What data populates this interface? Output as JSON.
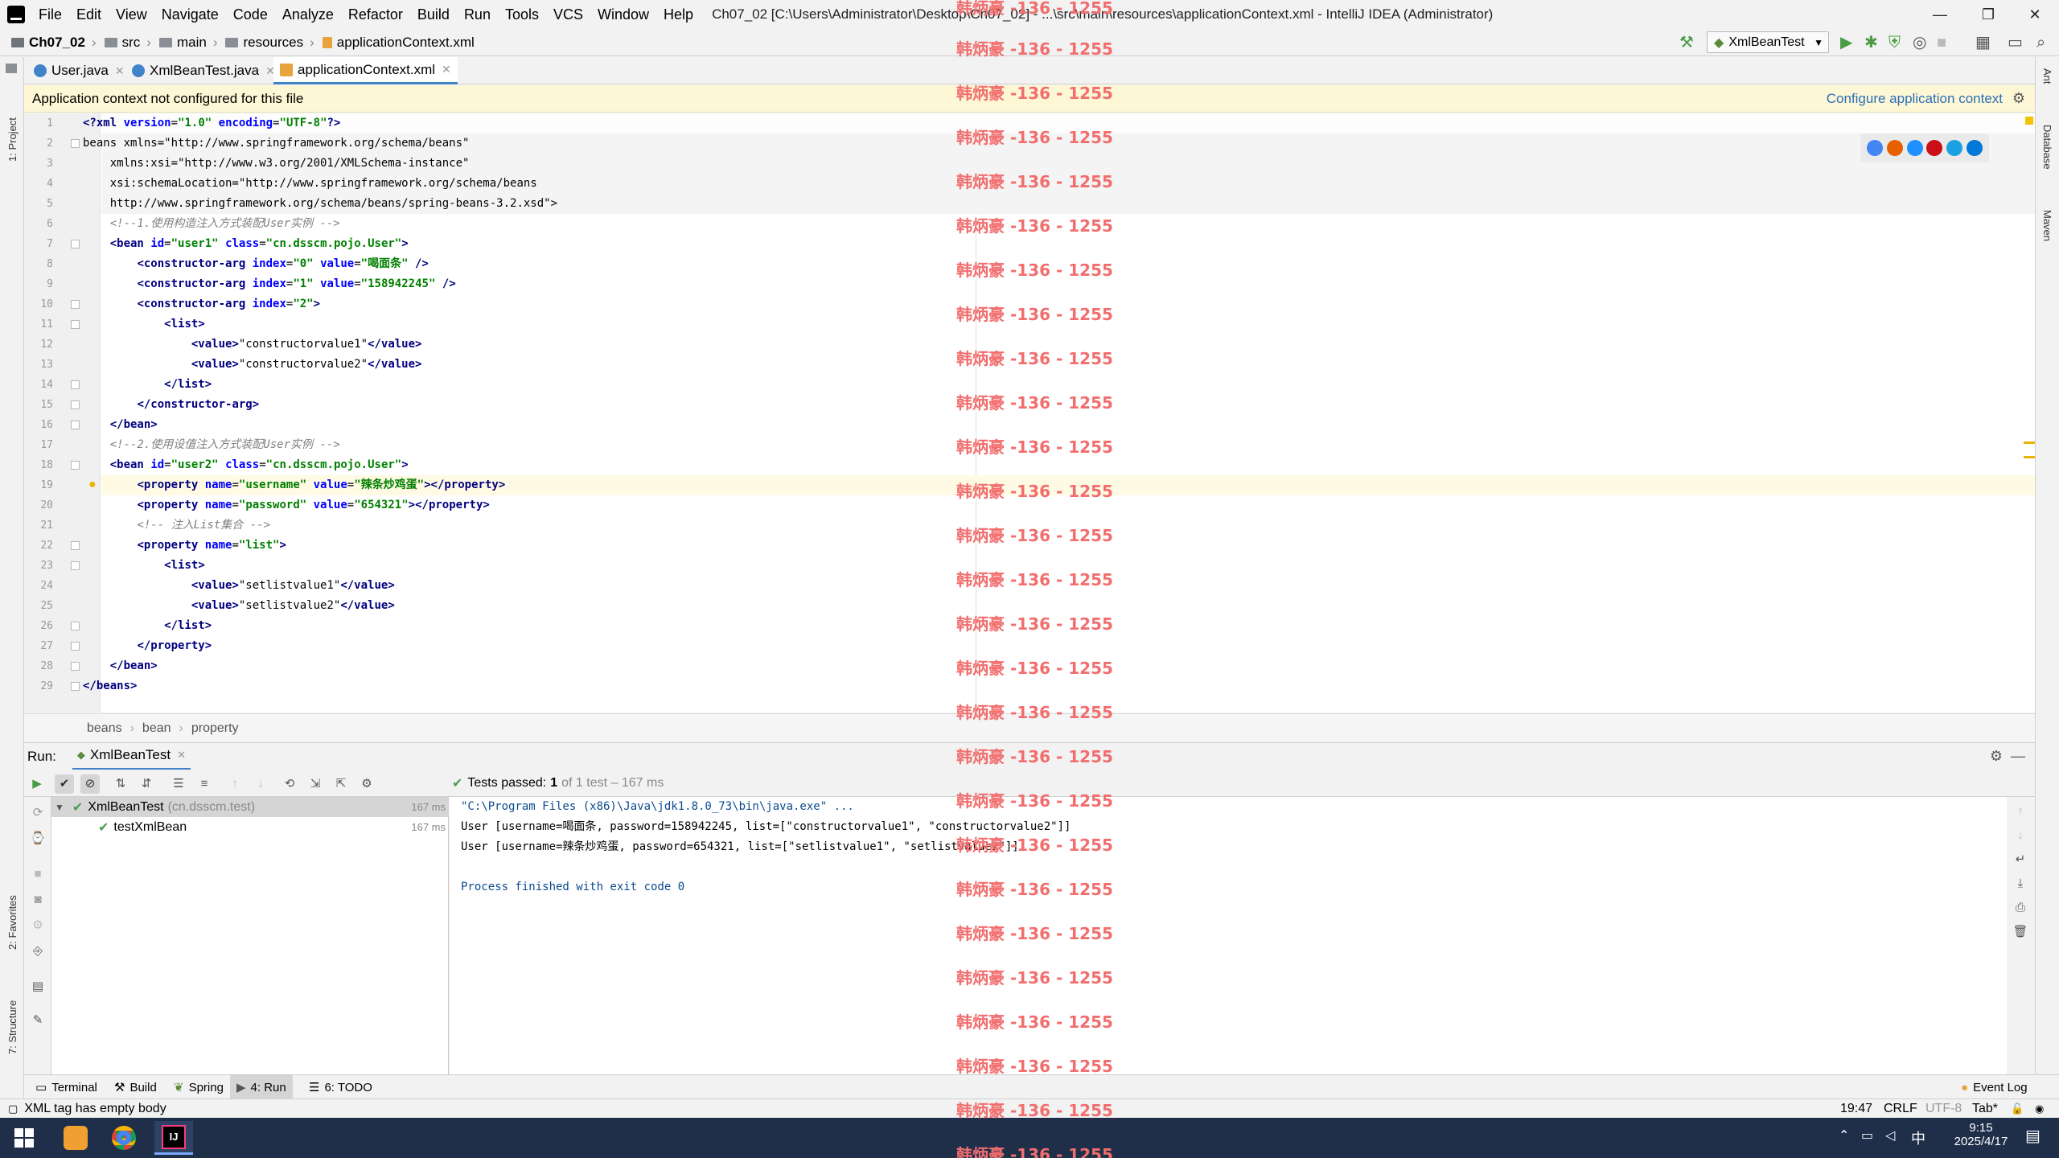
{
  "window": {
    "title": "Ch07_02 [C:\\Users\\Administrator\\Desktop\\Ch07_02] - ...\\src\\main\\resources\\applicationContext.xml - IntelliJ IDEA (Administrator)",
    "minimize": "—",
    "restore": "❐",
    "close": "✕"
  },
  "menu": [
    "File",
    "Edit",
    "View",
    "Navigate",
    "Code",
    "Analyze",
    "Refactor",
    "Build",
    "Run",
    "Tools",
    "VCS",
    "Window",
    "Help"
  ],
  "breadcrumb": [
    "Ch07_02",
    "src",
    "main",
    "resources",
    "applicationContext.xml"
  ],
  "run_config": "XmlBeanTest",
  "tabs": [
    {
      "label": "User.java",
      "color": "#4083c9"
    },
    {
      "label": "XmlBeanTest.java",
      "color": "#4083c9"
    },
    {
      "label": "applicationContext.xml",
      "color": "#e8a33d"
    }
  ],
  "banner": {
    "message": "Application context not configured for this file",
    "action": "Configure application context"
  },
  "code_lines": [
    "<?xml version=\"1.0\" encoding=\"UTF-8\"?>",
    "<beans xmlns=\"http://www.springframework.org/schema/beans\"",
    "    xmlns:xsi=\"http://www.w3.org/2001/XMLSchema-instance\"",
    "    xsi:schemaLocation=\"http://www.springframework.org/schema/beans",
    "    http://www.springframework.org/schema/beans/spring-beans-3.2.xsd\">",
    "    <!--1.使用构造注入方式装配User实例 -->",
    "    <bean id=\"user1\" class=\"cn.dsscm.pojo.User\">",
    "        <constructor-arg index=\"0\" value=\"喝面条\" />",
    "        <constructor-arg index=\"1\" value=\"158942245\" />",
    "        <constructor-arg index=\"2\">",
    "            <list>",
    "                <value>\"constructorvalue1\"</value>",
    "                <value>\"constructorvalue2\"</value>",
    "            </list>",
    "        </constructor-arg>",
    "    </bean>",
    "    <!--2.使用设值注入方式装配User实例 -->",
    "    <bean id=\"user2\" class=\"cn.dsscm.pojo.User\">",
    "        <property name=\"username\" value=\"辣条炒鸡蛋\"></property>",
    "        <property name=\"password\" value=\"654321\"></property>",
    "        <!-- 注入List集合 -->",
    "        <property name=\"list\">",
    "            <list>",
    "                <value>\"setlistvalue1\"</value>",
    "                <value>\"setlistvalue2\"</value>",
    "            </list>",
    "        </property>",
    "    </bean>",
    "</beans>"
  ],
  "editor_breadcrumb": [
    "beans",
    "bean",
    "property"
  ],
  "run": {
    "label": "Run:",
    "tab": "XmlBeanTest",
    "status_prefix": "Tests passed:",
    "status_count": "1",
    "status_suffix": "of 1 test – 167 ms",
    "tree": [
      {
        "name": "XmlBeanTest",
        "pkg": "(cn.dsscm.test)",
        "time": "167 ms"
      },
      {
        "name": "testXmlBean",
        "pkg": "",
        "time": "167 ms"
      }
    ],
    "console": [
      "\"C:\\Program Files (x86)\\Java\\jdk1.8.0_73\\bin\\java.exe\" ...",
      "User [username=喝面条, password=158942245, list=[\"constructorvalue1\", \"constructorvalue2\"]]",
      "User [username=辣条炒鸡蛋, password=654321, list=[\"setlistvalue1\", \"setlistvalue2\"]]",
      "",
      "Process finished with exit code 0"
    ]
  },
  "tool_tabs": [
    "Terminal",
    "Build",
    "Spring",
    "4: Run",
    "6: TODO"
  ],
  "event_log": "Event Log",
  "side": {
    "project": "1: Project",
    "favorites": "2: Favorites",
    "structure": "7: Structure",
    "ant": "Ant",
    "database": "Database",
    "maven": "Maven"
  },
  "status": {
    "message": "XML tag has empty body",
    "position": "19:47",
    "line_sep": "CRLF",
    "encoding": "UTF-8",
    "indent": "Tab*"
  },
  "taskbar": {
    "time": "9:15",
    "date": "2025/4/17",
    "ime": "中"
  },
  "watermark": "韩炳豪 -136 - 1255"
}
